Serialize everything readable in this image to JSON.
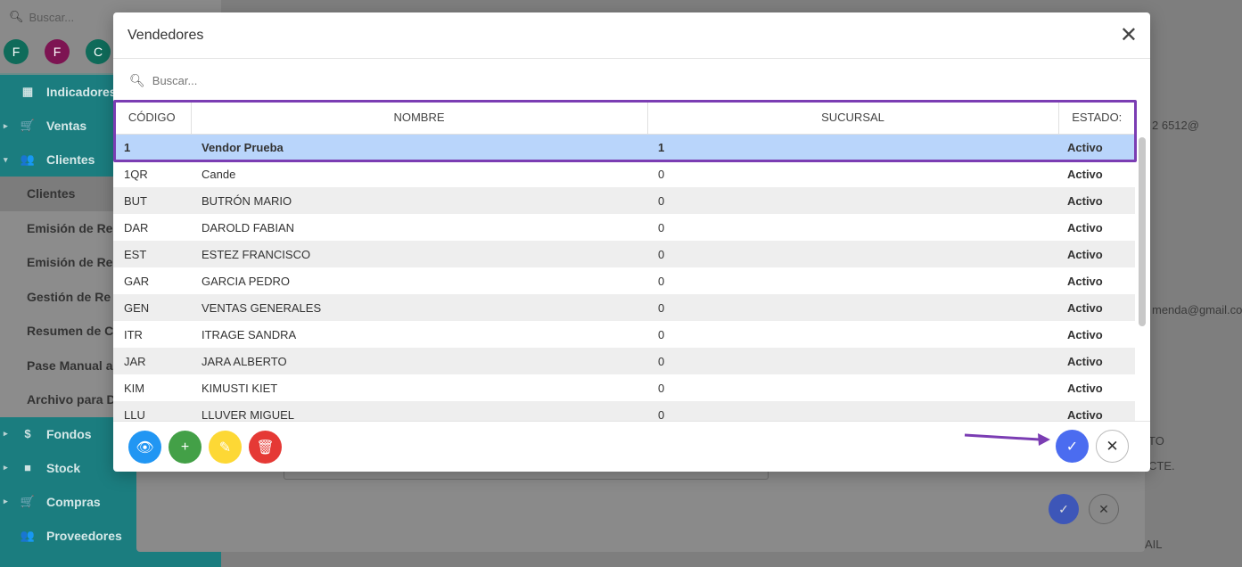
{
  "background": {
    "sidebar": {
      "search_placeholder": "Buscar...",
      "avatars": [
        {
          "letter": "F",
          "color": "#0f6b5a"
        },
        {
          "letter": "F",
          "color": "#7d1452"
        },
        {
          "letter": "C",
          "color": "#0f6b5a"
        }
      ],
      "nav": [
        {
          "label": "Indicadores",
          "icon": "dashboard-icon",
          "glyph": "▦",
          "caret": ""
        },
        {
          "label": "Ventas",
          "icon": "cart-icon",
          "glyph": "🛒",
          "caret": "▸"
        },
        {
          "label": "Clientes",
          "icon": "people-icon",
          "glyph": "👥",
          "caret": "▾"
        }
      ],
      "sub_items": [
        "Clientes",
        "Emisión de Re",
        "Emisión de Re",
        "Gestión de Re",
        "Resumen de C",
        "Pase Manual a",
        "Archivo para D"
      ],
      "nav_bottom": [
        {
          "label": "Fondos",
          "icon": "dollar-icon",
          "glyph": "$",
          "caret": "▸"
        },
        {
          "label": "Stock",
          "icon": "box-icon",
          "glyph": "■",
          "caret": "▸"
        },
        {
          "label": "Compras",
          "icon": "cart-icon",
          "glyph": "🛒",
          "caret": "▸"
        },
        {
          "label": "Proveedores",
          "icon": "people-icon",
          "glyph": "👥",
          "caret": ""
        }
      ]
    },
    "right_texts": [
      "2 6512@",
      "menda@gmail.con",
      "TO",
      "CTE.",
      "AIL"
    ]
  },
  "modal": {
    "title": "Vendedores",
    "search_placeholder": "Buscar...",
    "columns": [
      "CÓDIGO",
      "NOMBRE",
      "SUCURSAL",
      "ESTADO:"
    ],
    "rows": [
      {
        "codigo": "1",
        "nombre": "Vendor Prueba",
        "sucursal": "1",
        "estado": "Activo"
      },
      {
        "codigo": "1QR",
        "nombre": "Cande",
        "sucursal": "0",
        "estado": "Activo"
      },
      {
        "codigo": "BUT",
        "nombre": "BUTRÓN MARIO",
        "sucursal": "0",
        "estado": "Activo"
      },
      {
        "codigo": "DAR",
        "nombre": "DAROLD FABIAN",
        "sucursal": "0",
        "estado": "Activo"
      },
      {
        "codigo": "EST",
        "nombre": "ESTEZ FRANCISCO",
        "sucursal": "0",
        "estado": "Activo"
      },
      {
        "codigo": "GAR",
        "nombre": "GARCIA PEDRO",
        "sucursal": "0",
        "estado": "Activo"
      },
      {
        "codigo": "GEN",
        "nombre": "VENTAS GENERALES",
        "sucursal": "0",
        "estado": "Activo"
      },
      {
        "codigo": "ITR",
        "nombre": "ITRAGE SANDRA",
        "sucursal": "0",
        "estado": "Activo"
      },
      {
        "codigo": "JAR",
        "nombre": "JARA ALBERTO",
        "sucursal": "0",
        "estado": "Activo"
      },
      {
        "codigo": "KIM",
        "nombre": "KIMUSTI KIET",
        "sucursal": "0",
        "estado": "Activo"
      },
      {
        "codigo": "LLU",
        "nombre": "LLUVER MIGUEL",
        "sucursal": "0",
        "estado": "Activo"
      }
    ],
    "selected_row": 0,
    "footer_actions": [
      {
        "name": "view-button",
        "icon": "eye-icon",
        "glyph": "👁",
        "color": "#2196f3"
      },
      {
        "name": "add-button",
        "icon": "plus-icon",
        "glyph": "+",
        "color": "#43a047"
      },
      {
        "name": "edit-button",
        "icon": "pencil-icon",
        "glyph": "✎",
        "color": "#fdd835"
      },
      {
        "name": "delete-button",
        "icon": "trash-icon",
        "glyph": "🗑",
        "color": "#e53935"
      }
    ],
    "confirm_glyph": "✓",
    "cancel_glyph": "✕",
    "close_glyph": "✕",
    "highlight_color": "#7b3db3"
  }
}
